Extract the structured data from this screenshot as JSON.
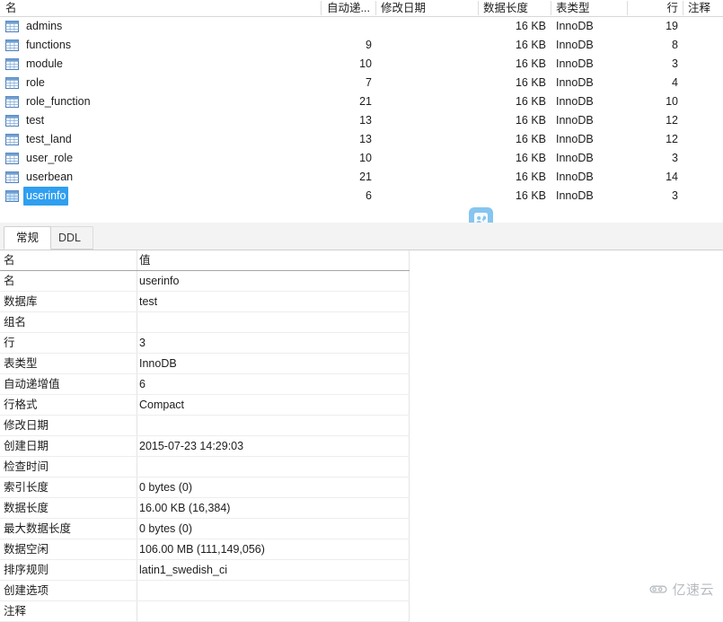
{
  "table_grid": {
    "columns": [
      {
        "key": "name",
        "label": "名"
      },
      {
        "key": "autoinc",
        "label": "自动递..."
      },
      {
        "key": "modified",
        "label": "修改日期"
      },
      {
        "key": "datalen",
        "label": "数据长度"
      },
      {
        "key": "tabletype",
        "label": "表类型"
      },
      {
        "key": "rows",
        "label": "行"
      },
      {
        "key": "comment",
        "label": "注释"
      }
    ],
    "rows": [
      {
        "name": "admins",
        "autoinc": "",
        "modified": "",
        "datalen": "16 KB",
        "tabletype": "InnoDB",
        "rows": "19",
        "comment": "",
        "selected": false
      },
      {
        "name": "functions",
        "autoinc": "9",
        "modified": "",
        "datalen": "16 KB",
        "tabletype": "InnoDB",
        "rows": "8",
        "comment": "",
        "selected": false
      },
      {
        "name": "module",
        "autoinc": "10",
        "modified": "",
        "datalen": "16 KB",
        "tabletype": "InnoDB",
        "rows": "3",
        "comment": "",
        "selected": false
      },
      {
        "name": "role",
        "autoinc": "7",
        "modified": "",
        "datalen": "16 KB",
        "tabletype": "InnoDB",
        "rows": "4",
        "comment": "",
        "selected": false
      },
      {
        "name": "role_function",
        "autoinc": "21",
        "modified": "",
        "datalen": "16 KB",
        "tabletype": "InnoDB",
        "rows": "10",
        "comment": "",
        "selected": false
      },
      {
        "name": "test",
        "autoinc": "13",
        "modified": "",
        "datalen": "16 KB",
        "tabletype": "InnoDB",
        "rows": "12",
        "comment": "",
        "selected": false
      },
      {
        "name": "test_land",
        "autoinc": "13",
        "modified": "",
        "datalen": "16 KB",
        "tabletype": "InnoDB",
        "rows": "12",
        "comment": "",
        "selected": false
      },
      {
        "name": "user_role",
        "autoinc": "10",
        "modified": "",
        "datalen": "16 KB",
        "tabletype": "InnoDB",
        "rows": "3",
        "comment": "",
        "selected": false
      },
      {
        "name": "userbean",
        "autoinc": "21",
        "modified": "",
        "datalen": "16 KB",
        "tabletype": "InnoDB",
        "rows": "14",
        "comment": "",
        "selected": false
      },
      {
        "name": "userinfo",
        "autoinc": "6",
        "modified": "",
        "datalen": "16 KB",
        "tabletype": "InnoDB",
        "rows": "3",
        "comment": "",
        "selected": true
      }
    ]
  },
  "tabs": [
    {
      "id": "general",
      "label": "常规",
      "active": true
    },
    {
      "id": "ddl",
      "label": "DDL",
      "active": false
    }
  ],
  "properties": {
    "header": {
      "name": "名",
      "value": "值"
    },
    "rows": [
      {
        "name": "名",
        "value": "userinfo"
      },
      {
        "name": "数据库",
        "value": "test"
      },
      {
        "name": "组名",
        "value": ""
      },
      {
        "name": "行",
        "value": "3"
      },
      {
        "name": "表类型",
        "value": "InnoDB"
      },
      {
        "name": "自动递增值",
        "value": "6"
      },
      {
        "name": "行格式",
        "value": "Compact"
      },
      {
        "name": "修改日期",
        "value": ""
      },
      {
        "name": "创建日期",
        "value": "2015-07-23 14:29:03"
      },
      {
        "name": "检查时间",
        "value": ""
      },
      {
        "name": "索引长度",
        "value": "0 bytes (0)"
      },
      {
        "name": "数据长度",
        "value": "16.00 KB (16,384)"
      },
      {
        "name": "最大数据长度",
        "value": "0 bytes (0)"
      },
      {
        "name": "数据空闲",
        "value": "106.00 MB (111,149,056)"
      },
      {
        "name": "排序规则",
        "value": "latin1_swedish_ci"
      },
      {
        "name": "创建选项",
        "value": ""
      },
      {
        "name": "注释",
        "value": ""
      }
    ]
  },
  "floating_badge": {
    "icon": "contact-card-icon"
  },
  "watermark": {
    "text": "亿速云",
    "icon": "cloud-logo-icon"
  },
  "colors": {
    "selection_blue": "#2f9ff0",
    "badge_blue": "#86c5ef",
    "grid_line": "#ededed",
    "tab_bar_bg": "#f3f3f3",
    "watermark_gray": "#8a9099"
  }
}
